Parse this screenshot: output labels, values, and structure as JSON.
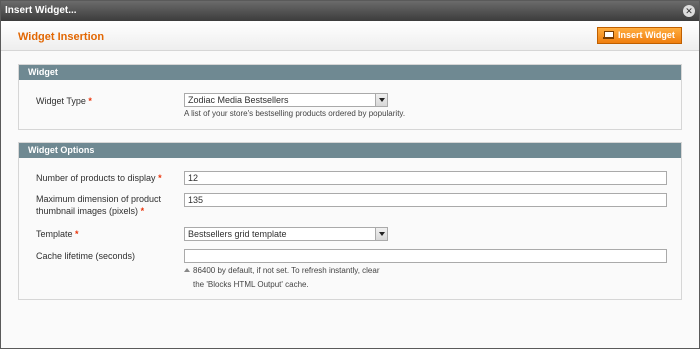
{
  "window": {
    "title": "Insert Widget..."
  },
  "header": {
    "title": "Widget Insertion",
    "insert_button": "Insert Widget"
  },
  "widget_section": {
    "title": "Widget",
    "type_label": "Widget Type",
    "type_value": "Zodiac Media Bestsellers",
    "type_note": "A list of your store's bestselling products ordered by popularity."
  },
  "options_section": {
    "title": "Widget Options",
    "products_label": "Number of products to display",
    "products_value": "12",
    "dimension_label_1": "Maximum dimension of product",
    "dimension_label_2": "thumbnail images (pixels)",
    "dimension_value": "135",
    "template_label": "Template",
    "template_value": "Bestsellers grid template",
    "cache_label": "Cache lifetime (seconds)",
    "cache_value": "",
    "cache_note_1": "86400 by default, if not set. To refresh instantly, clear",
    "cache_note_2": "the 'Blocks HTML Output' cache."
  },
  "required_marker": "*"
}
